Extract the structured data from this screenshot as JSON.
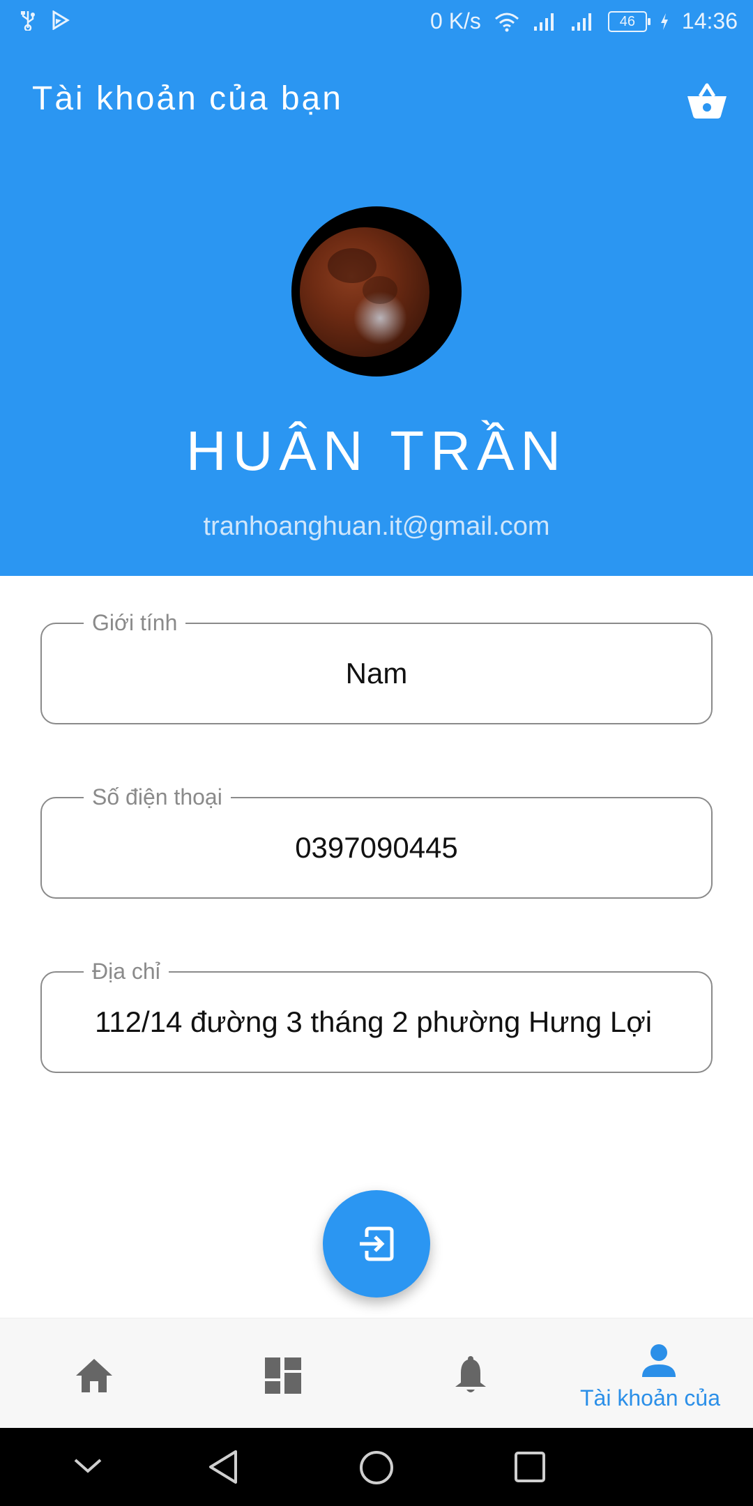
{
  "status_bar": {
    "network_speed": "0 K/s",
    "battery_level": "46",
    "time": "14:36",
    "icons": [
      "usb-icon",
      "play-store-icon",
      "wifi-icon",
      "signal-icon",
      "signal-icon",
      "battery-icon",
      "charging-icon"
    ]
  },
  "header": {
    "title": "Tài khoản của bạn",
    "cart_icon": "basket-icon",
    "background_color": "#2b96f2"
  },
  "profile": {
    "name": "HUÂN TRẦN",
    "email": "tranhoanghuan.it@gmail.com"
  },
  "fields": [
    {
      "label": "Giới tính",
      "value": "Nam"
    },
    {
      "label": "Số điện thoại",
      "value": "0397090445"
    },
    {
      "label": "Địa chỉ",
      "value": "112/14 đường 3 tháng 2 phường Hưng Lợi"
    }
  ],
  "fab": {
    "icon": "logout-icon",
    "color": "#2b96f2"
  },
  "bottom_nav": {
    "items": [
      {
        "icon": "home-icon",
        "label": ""
      },
      {
        "icon": "dashboard-icon",
        "label": ""
      },
      {
        "icon": "bell-icon",
        "label": ""
      },
      {
        "icon": "person-icon",
        "label": "Tài khoản của"
      }
    ],
    "active_color": "#2b8fe8",
    "inactive_color": "#666666"
  },
  "system_nav": [
    "chevron-down-icon",
    "back-icon",
    "home-circle-icon",
    "recents-icon"
  ]
}
